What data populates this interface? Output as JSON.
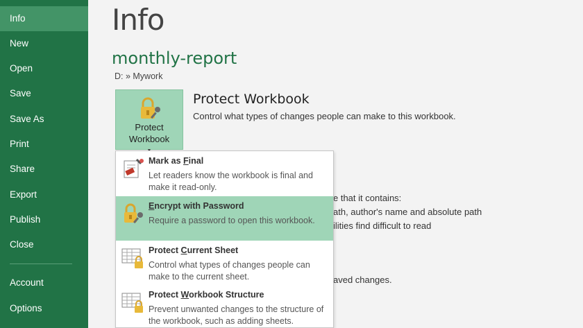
{
  "sidebar": {
    "items": [
      {
        "label": "Info",
        "active": true
      },
      {
        "label": "New"
      },
      {
        "label": "Open"
      },
      {
        "label": "Save"
      },
      {
        "label": "Save As"
      },
      {
        "label": "Print"
      },
      {
        "label": "Share"
      },
      {
        "label": "Export"
      },
      {
        "label": "Publish"
      },
      {
        "label": "Close"
      },
      {
        "label": "Account"
      },
      {
        "label": "Options"
      }
    ]
  },
  "main": {
    "title": "Info",
    "doc_name": "monthly-report",
    "doc_path": "D: » Mywork",
    "protect_button": {
      "line1": "Protect",
      "line2": "Workbook"
    },
    "section_title": "Protect Workbook",
    "section_desc": "Control what types of changes people can make to this workbook.",
    "background_text": [
      "e that it contains:",
      "ath, author's name and absolute path",
      "ilities find difficult to read",
      "aved changes."
    ]
  },
  "dropdown": {
    "items": [
      {
        "title_pre": "Mark as ",
        "title_ul": "F",
        "title_post": "inal",
        "desc": "Let readers know the workbook is final and make it read-only.",
        "icon": "mark-final-icon"
      },
      {
        "title_pre": "",
        "title_ul": "E",
        "title_post": "ncrypt with Password",
        "desc": "Require a password to open this workbook.",
        "icon": "lock-key-icon",
        "highlight": true
      },
      {
        "title_pre": "Protect ",
        "title_ul": "C",
        "title_post": "urrent Sheet",
        "desc": "Control what types of changes people can make to the current sheet.",
        "icon": "sheet-lock-icon"
      },
      {
        "title_pre": "Protect ",
        "title_ul": "W",
        "title_post": "orkbook Structure",
        "desc": "Prevent unwanted changes to the structure of the workbook, such as adding sheets.",
        "icon": "workbook-lock-icon"
      }
    ]
  },
  "colors": {
    "accent": "#217346",
    "highlight": "#9fd5b7",
    "sidebar_active": "#439467"
  }
}
